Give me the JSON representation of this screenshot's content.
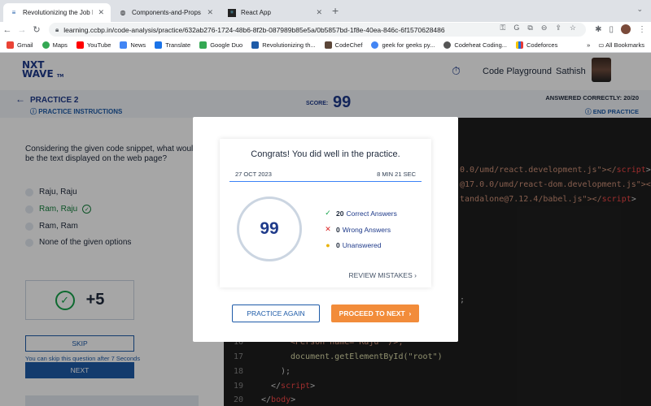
{
  "browser": {
    "tabs": [
      {
        "title": "Revolutionizing the Job Marke",
        "favicon": "ccbp-icon"
      },
      {
        "title": "Components-and-Props — CC",
        "favicon": "globe-icon"
      },
      {
        "title": "React App",
        "favicon": "react-icon"
      }
    ],
    "url": "learning.ccbp.in/code-analysis/practice/632ab276-1724-48b6-8f2b-087989b85e5a/0b5857bd-1f8e-40ea-846c-6f1570628486",
    "bookmarks": [
      "Gmail",
      "Maps",
      "YouTube",
      "News",
      "Translate",
      "Google Duo",
      "Revolutionizing th...",
      "CodeChef",
      "geek for geeks py...",
      "Codeheat Coding...",
      "Codeforces"
    ],
    "all_bookmarks": "All Bookmarks"
  },
  "header": {
    "logo_line1": "NXT",
    "logo_line2": "WAVE",
    "logo_tm": "TM",
    "playground": "Code Playground",
    "user": "Sathish"
  },
  "subheader": {
    "practice": "PRACTICE 2",
    "instructions": "PRACTICE INSTRUCTIONS",
    "score_label": "SCORE:",
    "score_value": "99",
    "answered": "ANSWERED CORRECTLY: 20/20",
    "end_practice": "END PRACTICE"
  },
  "question": {
    "text": "Considering the given code snippet, what would be the text displayed on the web page?",
    "options": [
      "Raju, Raju",
      "Ram, Raju",
      "Ram, Ram",
      "None of the given options"
    ],
    "plus_points": "+5",
    "skip": "SKIP",
    "skip_note": "You can skip this question after 7 Seconds",
    "next": "NEXT"
  },
  "code": {
    "line1_tail": "0.0/umd/react.development.js\"></",
    "line1_tag": "script",
    "line2_tail": "@17.0.0/umd/react-dom.development.js\"></",
    "line3_tail": "tandalone@7.12.4/babel.js\"></",
    "line3_tag": "script",
    "mid_semicolon": ";",
    "line_person": "<Person name=\"Raju\" />,",
    "ln16": "16",
    "ln17": "17",
    "ln18": "18",
    "ln19": "19",
    "ln20": "20",
    "line17": "document.getElementById(\"root\")",
    "line18": ");",
    "line19_open": "</",
    "line19_tag": "script",
    "line19_close": ">",
    "line20_open": "</",
    "line20_tag": "body",
    "line20_close": ">"
  },
  "modal": {
    "congrats": "Congrats! You did well in the practice.",
    "date": "27 OCT 2023",
    "duration": "8 MIN 21 SEC",
    "score": "99",
    "correct_count": "20",
    "correct_label": "Correct Answers",
    "wrong_count": "0",
    "wrong_label": "Wrong Answers",
    "unanswered_count": "0",
    "unanswered_label": "Unanswered",
    "review": "REVIEW MISTAKES",
    "practice_again": "PRACTICE AGAIN",
    "proceed": "PROCEED TO NEXT"
  }
}
